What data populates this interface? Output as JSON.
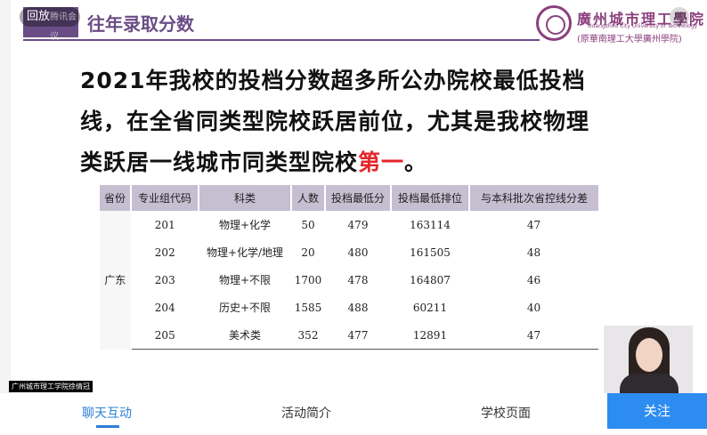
{
  "header": {
    "title": "往年录取分数"
  },
  "logo": {
    "name_cn": "廣州城市理工學院",
    "name_en": "Guangzhou City University of Technology",
    "subtitle": "(原華南理工大學廣州學院)"
  },
  "overlay": {
    "replay_label": "回放",
    "replay_sub": "腾讯会议",
    "close_symbol": "✕",
    "watermark": "广州城市理工学院徐倩冠"
  },
  "headline": {
    "part1": "2021年我校的投档分数超多所公办院校最低投档线，在全省同类型院校跃居前位，尤其是我校物理类跃居一线城市同类型院校",
    "highlight": "第一",
    "end": "。"
  },
  "table": {
    "headers": [
      "省份",
      "专业组代码",
      "科类",
      "人数",
      "投档最低分",
      "投档最低排位",
      "与本科批次省控线分差"
    ],
    "province": "广东",
    "rows": [
      {
        "code": "201",
        "category": "物理+化学",
        "count": "50",
        "min_score": "479",
        "min_rank": "163114",
        "diff": "47"
      },
      {
        "code": "202",
        "category": "物理+化学/地理",
        "count": "20",
        "min_score": "480",
        "min_rank": "161505",
        "diff": "48"
      },
      {
        "code": "203",
        "category": "物理+不限",
        "count": "1700",
        "min_score": "478",
        "min_rank": "164807",
        "diff": "46"
      },
      {
        "code": "204",
        "category": "历史+不限",
        "count": "1585",
        "min_score": "488",
        "min_rank": "60211",
        "diff": "40"
      },
      {
        "code": "205",
        "category": "美术类",
        "count": "352",
        "min_score": "477",
        "min_rank": "12891",
        "diff": "47"
      }
    ]
  },
  "bottom_nav": {
    "tabs": [
      "聊天互动",
      "活动简介",
      "学校页面"
    ],
    "active_tab": "聊天互动",
    "follow_label": "关注"
  },
  "colors": {
    "header_purple": "#6b4d86",
    "table_header": "#c6bfd2",
    "highlight_red": "#e4262a",
    "accent_blue": "#2d8cf0"
  }
}
